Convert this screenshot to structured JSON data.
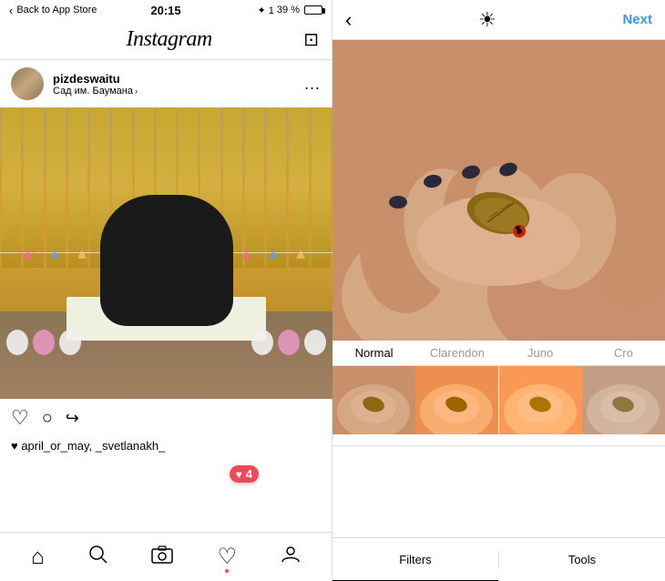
{
  "statusBar": {
    "backLabel": "Back to App Store",
    "time": "20:15",
    "signal": "✦ 1",
    "battery": "39 %"
  },
  "instagram": {
    "logo": "Instagram",
    "username": "pizdeswaitu",
    "location": "Сад им. Баумана",
    "locationArrow": ">",
    "menuDots": "...",
    "likes": "♥ april_or_may, _svetlanakh_",
    "notificationCount": "4"
  },
  "bottomNav": {
    "home": "⌂",
    "search": "🔍",
    "camera": "⊙",
    "heart": "♡",
    "profile": "◯"
  },
  "editor": {
    "backArrow": "‹",
    "brightnessIcon": "☀",
    "nextLabel": "Next",
    "filters": [
      {
        "name": "Normal",
        "active": true
      },
      {
        "name": "Clarendon",
        "active": false
      },
      {
        "name": "Juno",
        "active": false
      },
      {
        "name": "Cro",
        "active": false
      }
    ],
    "tabs": [
      {
        "label": "Filters",
        "active": true
      },
      {
        "label": "Tools",
        "active": false
      }
    ]
  }
}
